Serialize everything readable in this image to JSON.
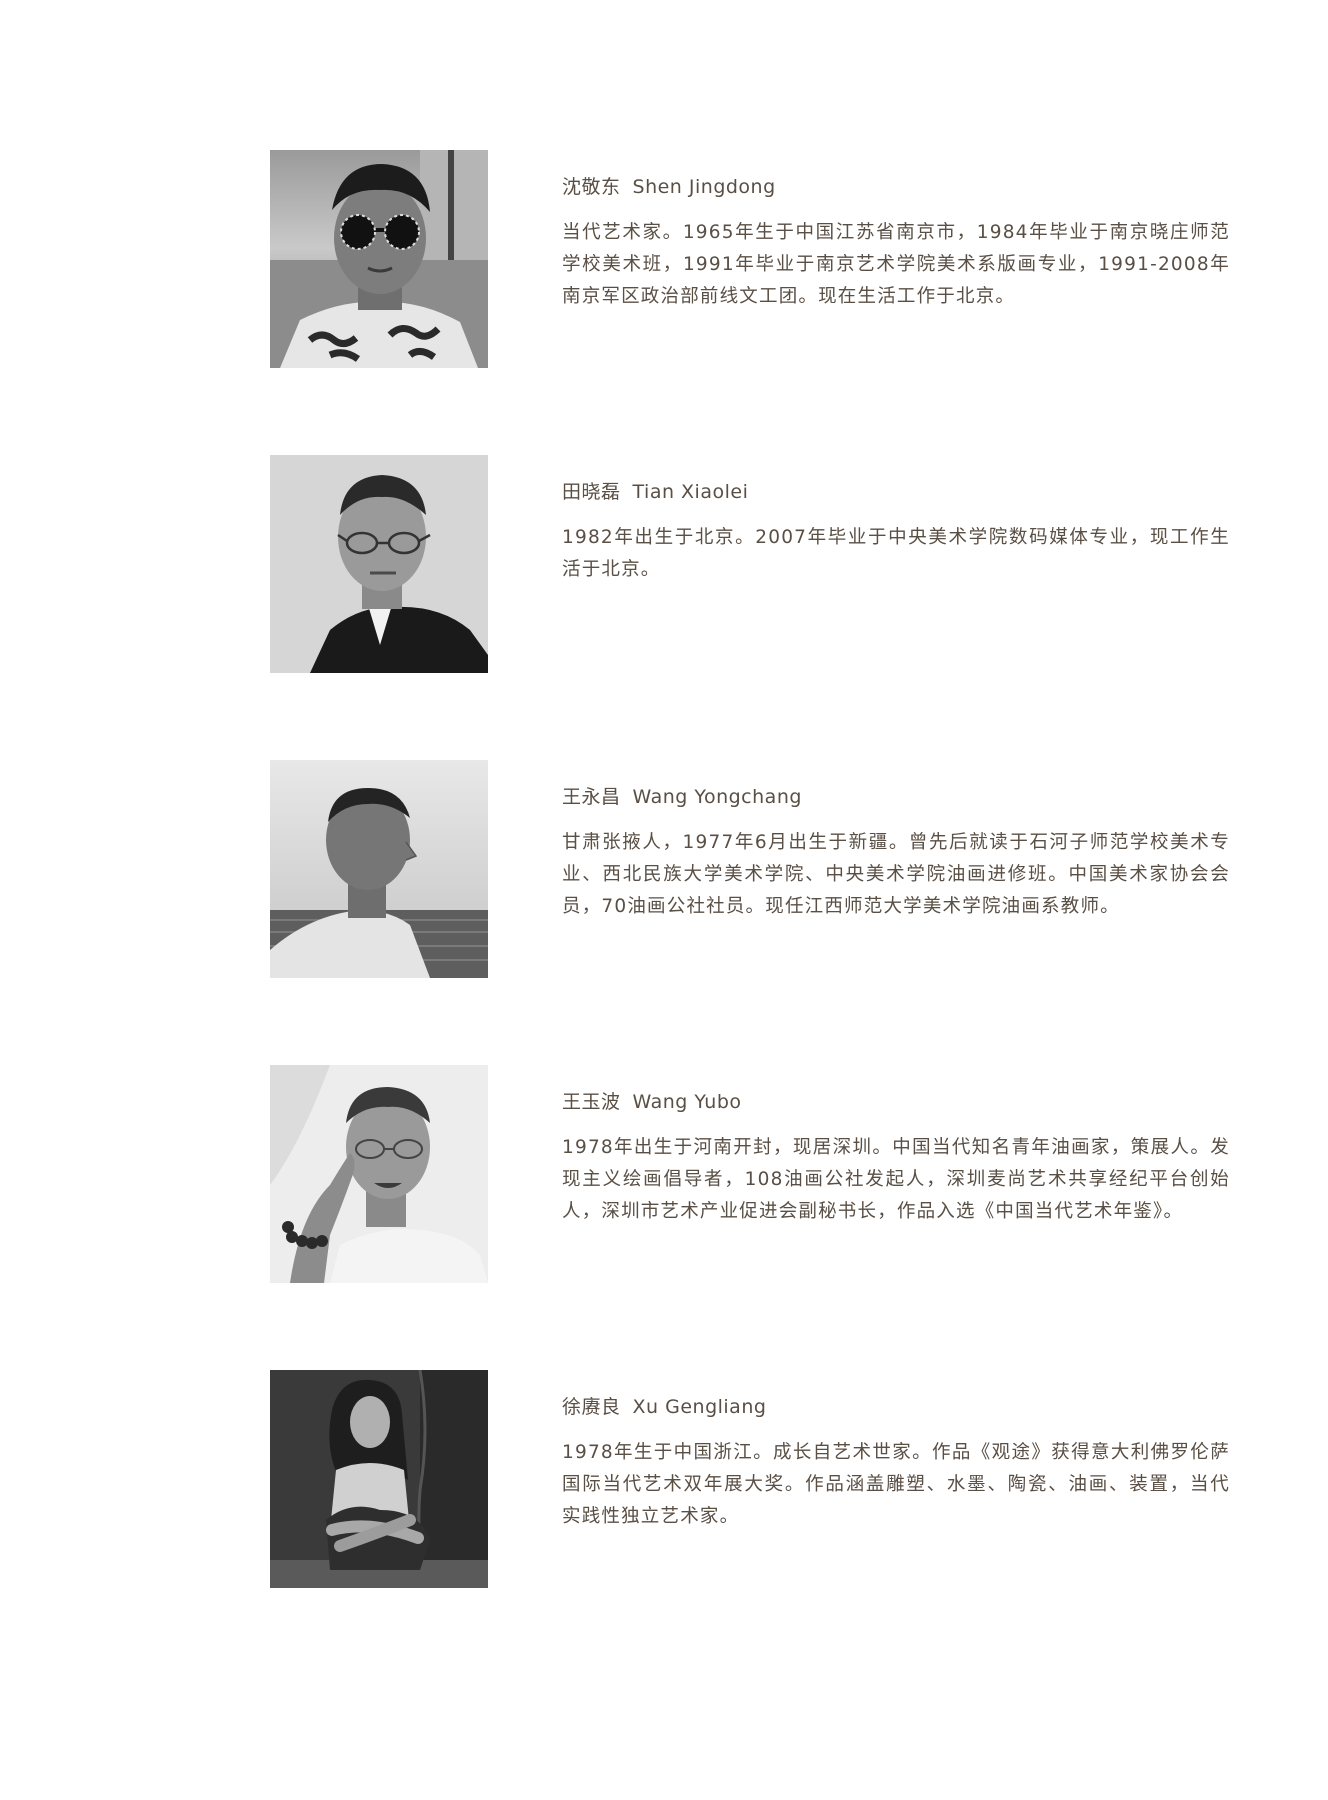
{
  "artists": [
    {
      "name_cn": "沈敬东",
      "name_en": "Shen Jingdong",
      "bio": "当代艺术家。1965年生于中国江苏省南京市，1984年毕业于南京晓庄师范学校美术班，1991年毕业于南京艺术学院美术系版画专业，1991-2008年南京军区政治部前线文工团。现在生活工作于北京。"
    },
    {
      "name_cn": "田晓磊",
      "name_en": "Tian Xiaolei",
      "bio": "1982年出生于北京。2007年毕业于中央美术学院数码媒体专业，现工作生活于北京。"
    },
    {
      "name_cn": "王永昌",
      "name_en": "Wang Yongchang",
      "bio": "甘肃张掖人，1977年6月出生于新疆。曾先后就读于石河子师范学校美术专业、西北民族大学美术学院、中央美术学院油画进修班。中国美术家协会会员，70油画公社社员。现任江西师范大学美术学院油画系教师。"
    },
    {
      "name_cn": "王玉波",
      "name_en": "Wang Yubo",
      "bio": "1978年出生于河南开封，现居深圳。中国当代知名青年油画家，策展人。发现主义绘画倡导者，108油画公社发起人，深圳麦尚艺术共享经纪平台创始人，深圳市艺术产业促进会副秘书长，作品入选《中国当代艺术年鉴》。"
    },
    {
      "name_cn": "徐赓良",
      "name_en": "Xu Gengliang",
      "bio": "1978年生于中国浙江。成长自艺术世家。作品《观途》获得意大利佛罗伦萨国际当代艺术双年展大奖。作品涵盖雕塑、水墨、陶瓷、油画、装置，当代实践性独立艺术家。"
    }
  ],
  "colors": {
    "text": "#5a4f45",
    "background": "#ffffff"
  }
}
